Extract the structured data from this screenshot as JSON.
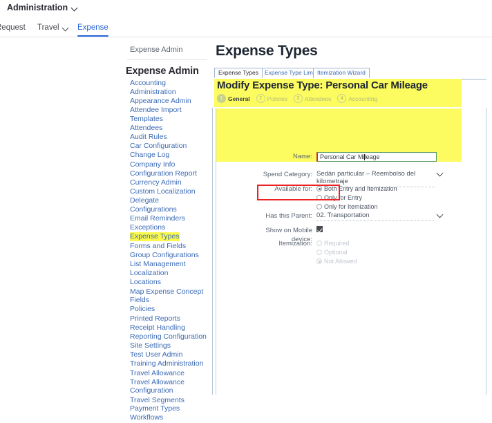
{
  "topbar": {
    "admin_menu": "Administration",
    "nav": [
      {
        "label": "Request",
        "has_chevron": false,
        "active": false
      },
      {
        "label": "Travel",
        "has_chevron": true,
        "active": false
      },
      {
        "label": "Expense",
        "has_chevron": false,
        "active": true
      }
    ]
  },
  "sidebar": {
    "breadcrumb": "Expense Admin",
    "title": "Expense Admin",
    "items": [
      {
        "label": "Accounting Administration",
        "highlighted": false
      },
      {
        "label": "Appearance Admin",
        "highlighted": false
      },
      {
        "label": "Attendee Import Templates",
        "highlighted": false
      },
      {
        "label": "Attendees",
        "highlighted": false
      },
      {
        "label": "Audit Rules",
        "highlighted": false
      },
      {
        "label": "Car Configuration",
        "highlighted": false
      },
      {
        "label": "Change Log",
        "highlighted": false
      },
      {
        "label": "Company Info",
        "highlighted": false
      },
      {
        "label": "Configuration Report",
        "highlighted": false
      },
      {
        "label": "Currency Admin",
        "highlighted": false
      },
      {
        "label": "Custom Localization",
        "highlighted": false
      },
      {
        "label": "Delegate Configurations",
        "highlighted": false
      },
      {
        "label": "Email Reminders",
        "highlighted": false
      },
      {
        "label": "Exceptions",
        "highlighted": false
      },
      {
        "label": "Expense Types",
        "highlighted": true
      },
      {
        "label": "Forms and Fields",
        "highlighted": false
      },
      {
        "label": "Group Configurations",
        "highlighted": false
      },
      {
        "label": "List Management",
        "highlighted": false
      },
      {
        "label": "Localization",
        "highlighted": false
      },
      {
        "label": "Locations",
        "highlighted": false
      },
      {
        "label": "Map Expense Concept Fields",
        "highlighted": false
      },
      {
        "label": "Policies",
        "highlighted": false
      },
      {
        "label": "Printed Reports",
        "highlighted": false
      },
      {
        "label": "Receipt Handling",
        "highlighted": false
      },
      {
        "label": "Reporting Configuration",
        "highlighted": false
      },
      {
        "label": "Site Settings",
        "highlighted": false
      },
      {
        "label": "Test User Admin",
        "highlighted": false
      },
      {
        "label": "Training Administration",
        "highlighted": false
      },
      {
        "label": "Travel Allowance",
        "highlighted": false
      },
      {
        "label": "Travel Allowance Configuration",
        "highlighted": false
      },
      {
        "label": "Travel Segments Payment Types",
        "highlighted": false
      },
      {
        "label": "Workflows",
        "highlighted": false
      }
    ]
  },
  "main": {
    "page_title": "Expense Types",
    "tabs": [
      {
        "label": "Expense Types",
        "active": true
      },
      {
        "label": "Expense Type Limits",
        "active": false
      },
      {
        "label": "Itemization Wizard",
        "active": false
      }
    ],
    "modify_title": "Modify Expense Type: Personal Car Mileage",
    "steps": [
      {
        "num": "1",
        "label": "General",
        "active": true
      },
      {
        "num": "2",
        "label": "Policies",
        "active": false
      },
      {
        "num": "3",
        "label": "Attendees",
        "active": false
      },
      {
        "num": "4",
        "label": "Accounting",
        "active": false
      }
    ],
    "form": {
      "name_label": "Name:",
      "name_value": "Personal Car Mileage",
      "spend_category_label": "Spend Category:",
      "spend_category_value": "Sedán particular – Reembolso del kilometraje",
      "available_for_label": "Available for:",
      "available_for_options": [
        {
          "label": "Both Entry and Itemization",
          "selected": true
        },
        {
          "label": "Only for Entry",
          "selected": false
        },
        {
          "label": "Only for Itemization",
          "selected": false
        }
      ],
      "parent_label": "Has this Parent:",
      "parent_value": "02. Transportation",
      "mobile_label": "Show on Mobile device:",
      "mobile_checked": true,
      "itemization_label": "Itemization:",
      "itemization_options": [
        {
          "label": "Required",
          "selected": false
        },
        {
          "label": "Optional",
          "selected": false
        },
        {
          "label": "Not Allowed",
          "selected": true
        }
      ]
    }
  },
  "colors": {
    "highlight_yellow": "#fcfc60",
    "annotation_red": "#ee2222",
    "link_blue": "#3b6bb5",
    "accent_blue": "#2767d6",
    "field_green": "#5c9b63"
  }
}
